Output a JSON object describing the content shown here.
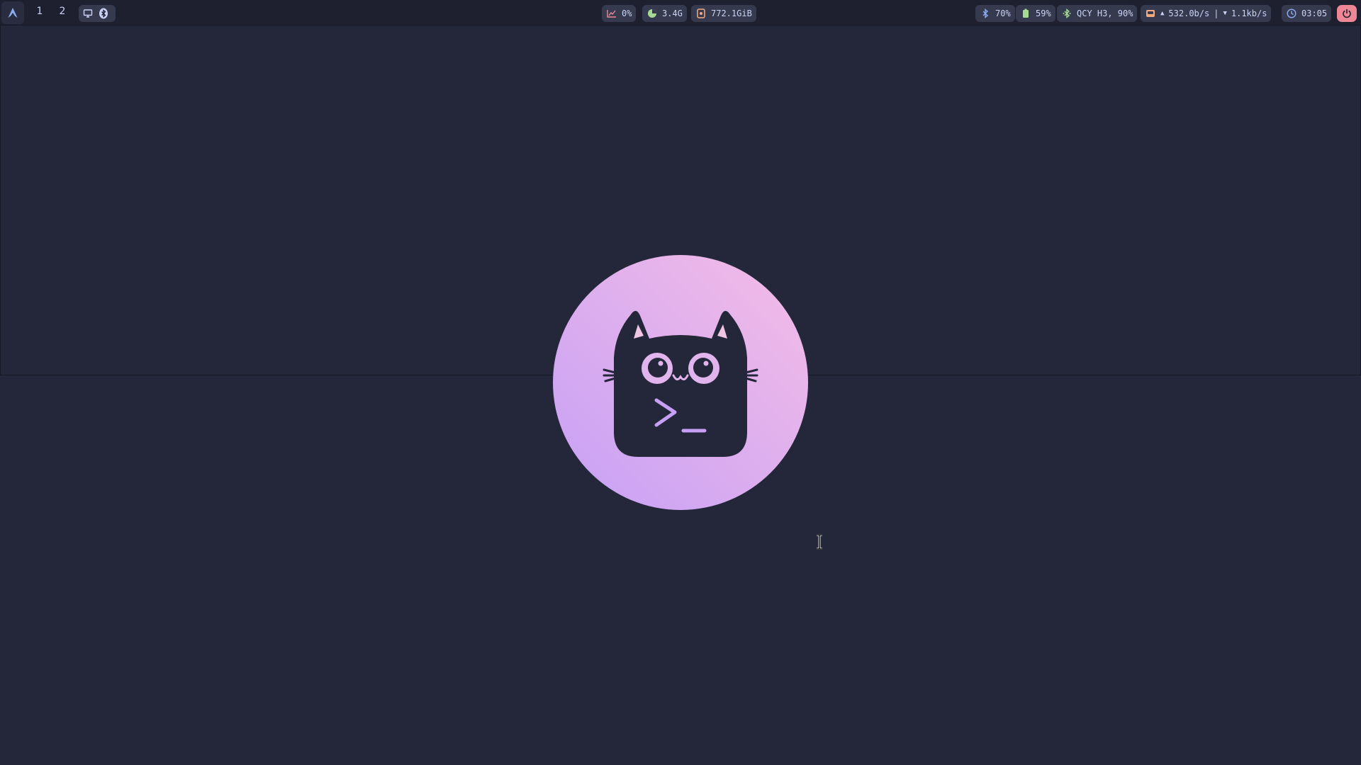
{
  "workspaces": [
    "1",
    "2"
  ],
  "stats": {
    "cpu": "0%",
    "memory": "3.4G",
    "disk": "772.1GiB"
  },
  "status": {
    "bluetooth_level": "70%",
    "battery": "59%",
    "device": "QCY H3, 90%",
    "network": "532.0b/s | 1.1kb/s",
    "network_up": "532.0b/s",
    "network_down": "1.1kb/s",
    "clock": "03:05"
  },
  "icons": {
    "launcher": "arch-logo-icon",
    "display": "monitor-icon",
    "bluetooth": "bluetooth-icon",
    "cpu": "chart-icon",
    "memory": "memory-icon",
    "disk": "disk-icon",
    "battery": "battery-icon",
    "device": "bluetooth-device-icon",
    "network": "network-icon",
    "clock": "clock-icon",
    "power": "power-icon"
  },
  "colors": {
    "background": "#24273a",
    "bar": "#1e2030",
    "pill": "#363a4f",
    "logo_gradient_top": "#f5bde6",
    "logo_gradient_bottom": "#c6a0f6",
    "power": "#ed8796"
  }
}
